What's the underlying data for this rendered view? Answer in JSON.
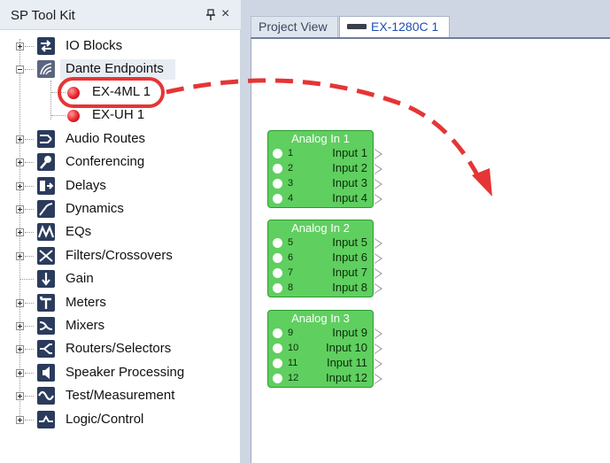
{
  "panel": {
    "title": "SP Tool Kit",
    "pin_icon": "pin-icon",
    "close_icon": "close-icon",
    "close_glyph": "×"
  },
  "tree": {
    "categories": [
      {
        "label": "IO Blocks",
        "icon": "io-blocks-icon"
      },
      {
        "label": "Dante Endpoints",
        "icon": "dante-endpoints-icon"
      },
      {
        "label": "Audio Routes",
        "icon": "audio-routes-icon"
      },
      {
        "label": "Conferencing",
        "icon": "conferencing-icon"
      },
      {
        "label": "Delays",
        "icon": "delays-icon"
      },
      {
        "label": "Dynamics",
        "icon": "dynamics-icon"
      },
      {
        "label": "EQs",
        "icon": "eqs-icon"
      },
      {
        "label": "Filters/Crossovers",
        "icon": "filters-icon"
      },
      {
        "label": "Gain",
        "icon": "gain-icon"
      },
      {
        "label": "Meters",
        "icon": "meters-icon"
      },
      {
        "label": "Mixers",
        "icon": "mixers-icon"
      },
      {
        "label": "Routers/Selectors",
        "icon": "routers-icon"
      },
      {
        "label": "Speaker Processing",
        "icon": "speaker-icon"
      },
      {
        "label": "Test/Measurement",
        "icon": "test-icon"
      },
      {
        "label": "Logic/Control",
        "icon": "logic-icon"
      }
    ],
    "dante_children": [
      {
        "label": "EX-4ML 1",
        "icon": "red-led-icon"
      },
      {
        "label": "EX-UH 1",
        "icon": "red-led-icon"
      }
    ]
  },
  "tabs": [
    {
      "label": "Project View"
    },
    {
      "label": "EX-1280C 1",
      "icon": "device-icon"
    }
  ],
  "blocks": [
    {
      "title": "Analog In 1",
      "rows": [
        {
          "num": "1",
          "label": "Input 1"
        },
        {
          "num": "2",
          "label": "Input 2"
        },
        {
          "num": "3",
          "label": "Input 3"
        },
        {
          "num": "4",
          "label": "Input 4"
        }
      ]
    },
    {
      "title": "Analog In 2",
      "rows": [
        {
          "num": "5",
          "label": "Input 5"
        },
        {
          "num": "6",
          "label": "Input 6"
        },
        {
          "num": "7",
          "label": "Input 7"
        },
        {
          "num": "8",
          "label": "Input 8"
        }
      ]
    },
    {
      "title": "Analog In 3",
      "rows": [
        {
          "num": "9",
          "label": "Input 9"
        },
        {
          "num": "10",
          "label": "Input 10"
        },
        {
          "num": "11",
          "label": "Input 11"
        },
        {
          "num": "12",
          "label": "Input 12"
        }
      ]
    }
  ],
  "colors": {
    "callout": "#e53535",
    "block_green": "#5fcf5f",
    "active_tab_text": "#1f4fb6"
  }
}
